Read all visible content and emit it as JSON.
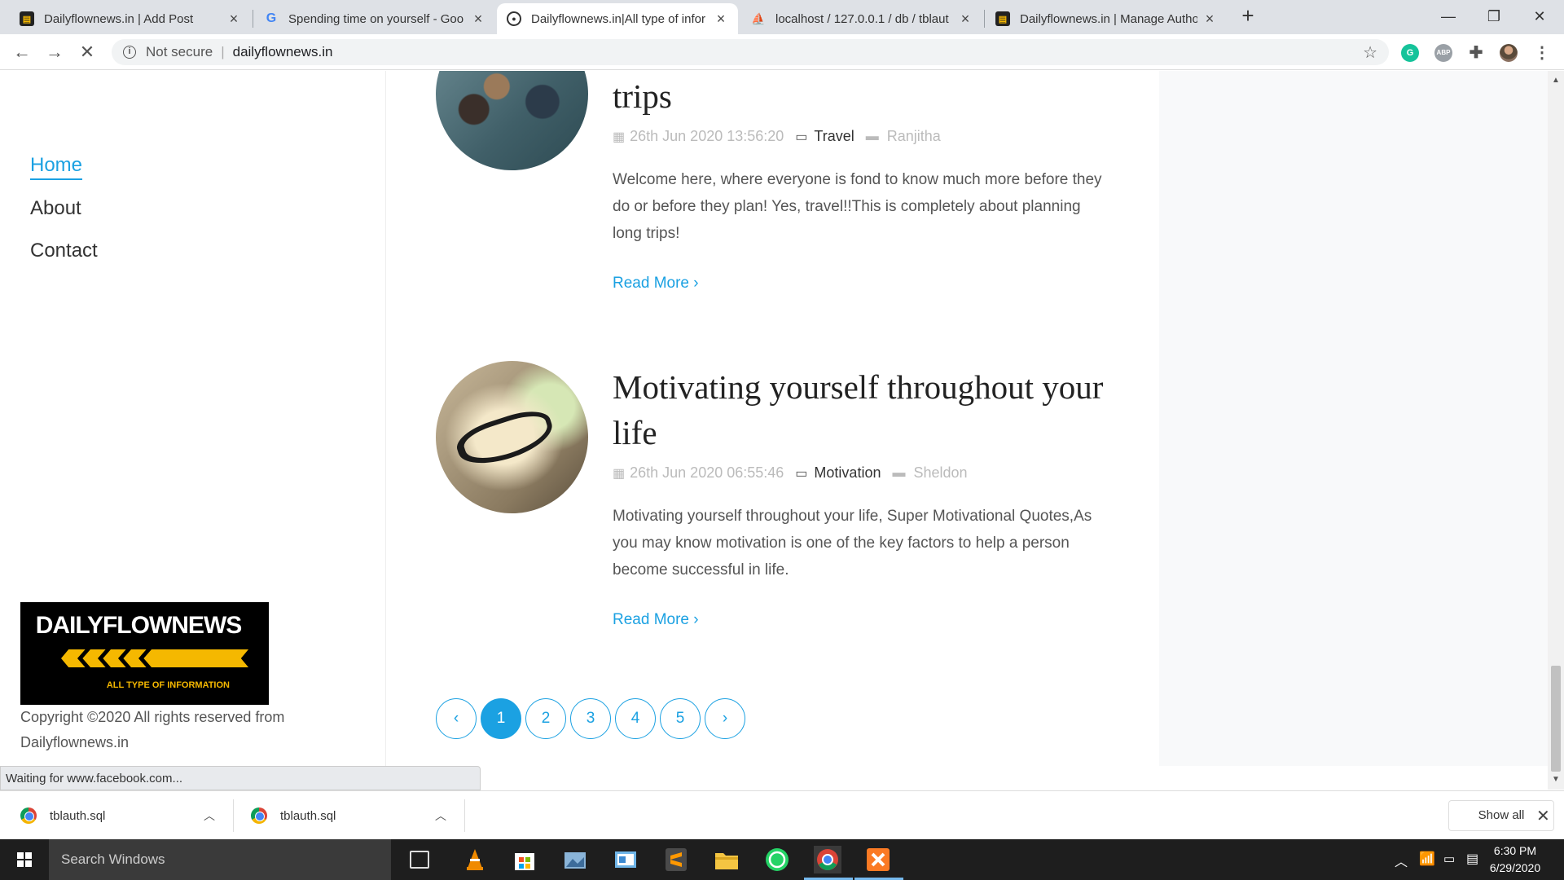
{
  "browser": {
    "tabs": [
      {
        "title": "Dailyflownews.in | Add Post",
        "favicon": "dailyflownews-favicon"
      },
      {
        "title": "Spending time on yourself - Goo",
        "favicon": "google-favicon"
      },
      {
        "title": "Dailyflownews.in|All type of infor",
        "favicon": "dailyflownews-round-favicon"
      },
      {
        "title": "localhost / 127.0.0.1 / db / tblaut",
        "favicon": "phpmyadmin-favicon"
      },
      {
        "title": "Dailyflownews.in | Manage Autho",
        "favicon": "dailyflownews-favicon"
      }
    ],
    "security_label": "Not secure",
    "url": "dailyflownews.in",
    "status_text": "Waiting for www.facebook.com..."
  },
  "site": {
    "nav": [
      {
        "label": "Home",
        "active": true
      },
      {
        "label": "About",
        "active": false
      },
      {
        "label": "Contact",
        "active": false
      }
    ],
    "logo": {
      "title": "DAILYFLOWNEWS",
      "tagline": "ALL TYPE OF INFORMATION"
    },
    "copyright": "Copyright ©2020 All rights reserved from Dailyflownews.in"
  },
  "posts": [
    {
      "title": "trips",
      "date": "26th Jun 2020 13:56:20",
      "category": "Travel",
      "author": "Ranjitha",
      "excerpt": "Welcome here, where everyone is fond to know much more before they do or before they plan! Yes, travel!!This is completely about planning long trips!",
      "read_more": "Read More"
    },
    {
      "title": "Motivating yourself throughout your life",
      "date": "26th Jun 2020 06:55:46",
      "category": "Motivation",
      "author": "Sheldon",
      "excerpt": "Motivating yourself throughout your life, Super Motivational Quotes,As you may know motivation is one of the key factors to help a person become successful in life.",
      "read_more": "Read More"
    }
  ],
  "pagination": {
    "prev": "‹",
    "pages": [
      "1",
      "2",
      "3",
      "4",
      "5"
    ],
    "current": "1",
    "next": "›"
  },
  "downloads": {
    "items": [
      {
        "name": "tblauth.sql"
      },
      {
        "name": "tblauth.sql"
      }
    ],
    "show_all": "Show all"
  },
  "taskbar": {
    "search_placeholder": "Search Windows",
    "time": "6:30 PM",
    "date": "6/29/2020"
  },
  "colors": {
    "accent": "#1ba1e2",
    "logo_yellow": "#f5b800"
  }
}
